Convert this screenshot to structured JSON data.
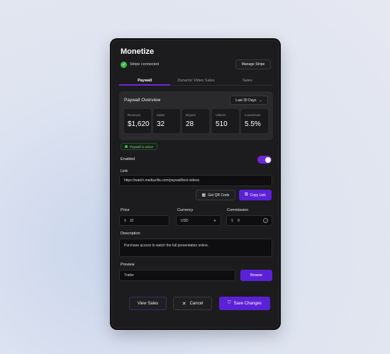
{
  "panel": {
    "title": "Monetize",
    "stripe_status": "Stripe connected",
    "manage_stripe": "Manage Stripe",
    "tabs": [
      {
        "label": "Paywall",
        "active": true
      },
      {
        "label": "Dynamic Video Sales",
        "active": false
      },
      {
        "label": "Sales",
        "active": false
      }
    ]
  },
  "overview": {
    "title": "Paywall Overview",
    "range": "Last 30 Days",
    "stats": [
      {
        "label": "Revenue",
        "value": "$1,620"
      },
      {
        "label": "Sales",
        "value": "32"
      },
      {
        "label": "Buyers",
        "value": "28"
      },
      {
        "label": "Visitors",
        "value": "510"
      },
      {
        "label": "Conversion",
        "value": "5.5%"
      }
    ]
  },
  "status": {
    "badge": "Paywall is active",
    "badge_color": "#3fb950"
  },
  "enabled": {
    "label": "Enabled",
    "on": true
  },
  "link": {
    "label": "Link",
    "value": "https://watch.mediazilla.com/paywall/test-videos",
    "qr_button": "Get QR Code",
    "copy_button": "Copy Link"
  },
  "pricing": {
    "price_label": "Price",
    "price_symbol": "$",
    "price_value": "10",
    "currency_label": "Currency",
    "currency_value": "USD",
    "commission_label": "Commission",
    "commission_symbol": "$",
    "commission_value": "0"
  },
  "description": {
    "label": "Description",
    "value": "Purchase access to watch the full presentation online."
  },
  "preview": {
    "label": "Preview",
    "value": "Trailer",
    "browse_button": "Browse"
  },
  "footer": {
    "view_sales": "View Sales",
    "cancel": "Cancel",
    "save": "Save Changes"
  },
  "colors": {
    "accent": "#5b21d6",
    "panel_bg": "#1c1c1e",
    "success": "#3fb950"
  }
}
